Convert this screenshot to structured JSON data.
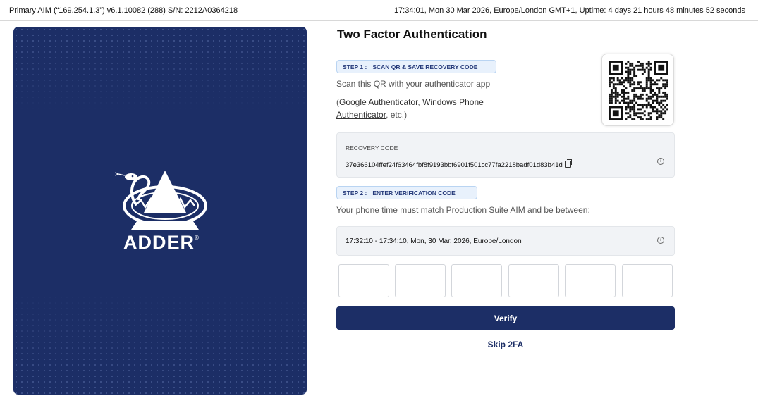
{
  "status_bar": {
    "system_info": "Primary AIM (“169.254.1.3”) v6.1.10082 (288) S/N: 2212A0364218",
    "clock_info": "17:34:01, Mon 30 Mar 2026, Europe/London GMT+1, Uptime: 4 days 21 hours 48 minutes 52 seconds"
  },
  "brand": {
    "logo_text": "ADDER",
    "registered_mark": "®",
    "panel_color": "#1c2e66"
  },
  "page": {
    "title": "Two Factor Authentication"
  },
  "step1": {
    "number": "STEP 1 :",
    "label": "SCAN QR & SAVE RECOVERY CODE",
    "scan_instruction": "Scan this QR with your authenticator app",
    "open_paren": "(",
    "app1": "Google Authenticator",
    "comma": ", ",
    "app2": "Windows Phone Authenticator",
    "etc": ", etc.)",
    "qr_icon": "qr-code"
  },
  "recovery": {
    "label": "RECOVERY CODE",
    "code": "37e366104ffef24f63464fbf8f9193bbf6901f501cc77fa2218badf01d83b41d",
    "copy_icon": "copy-icon",
    "info_icon": "info-icon"
  },
  "step2": {
    "number": "STEP 2 :",
    "label": "ENTER VERIFICATION CODE",
    "phone_instruction": "Your phone time must match Production Suite AIM and be between:",
    "time_range": "17:32:10 - 17:34:10, Mon, 30 Mar, 2026, Europe/London",
    "info_icon": "info-icon"
  },
  "otp": {
    "digits": [
      "",
      "",
      "",
      "",
      "",
      ""
    ]
  },
  "actions": {
    "verify_label": "Verify",
    "skip_label": "Skip 2FA",
    "primary_color": "#1c2e66"
  }
}
